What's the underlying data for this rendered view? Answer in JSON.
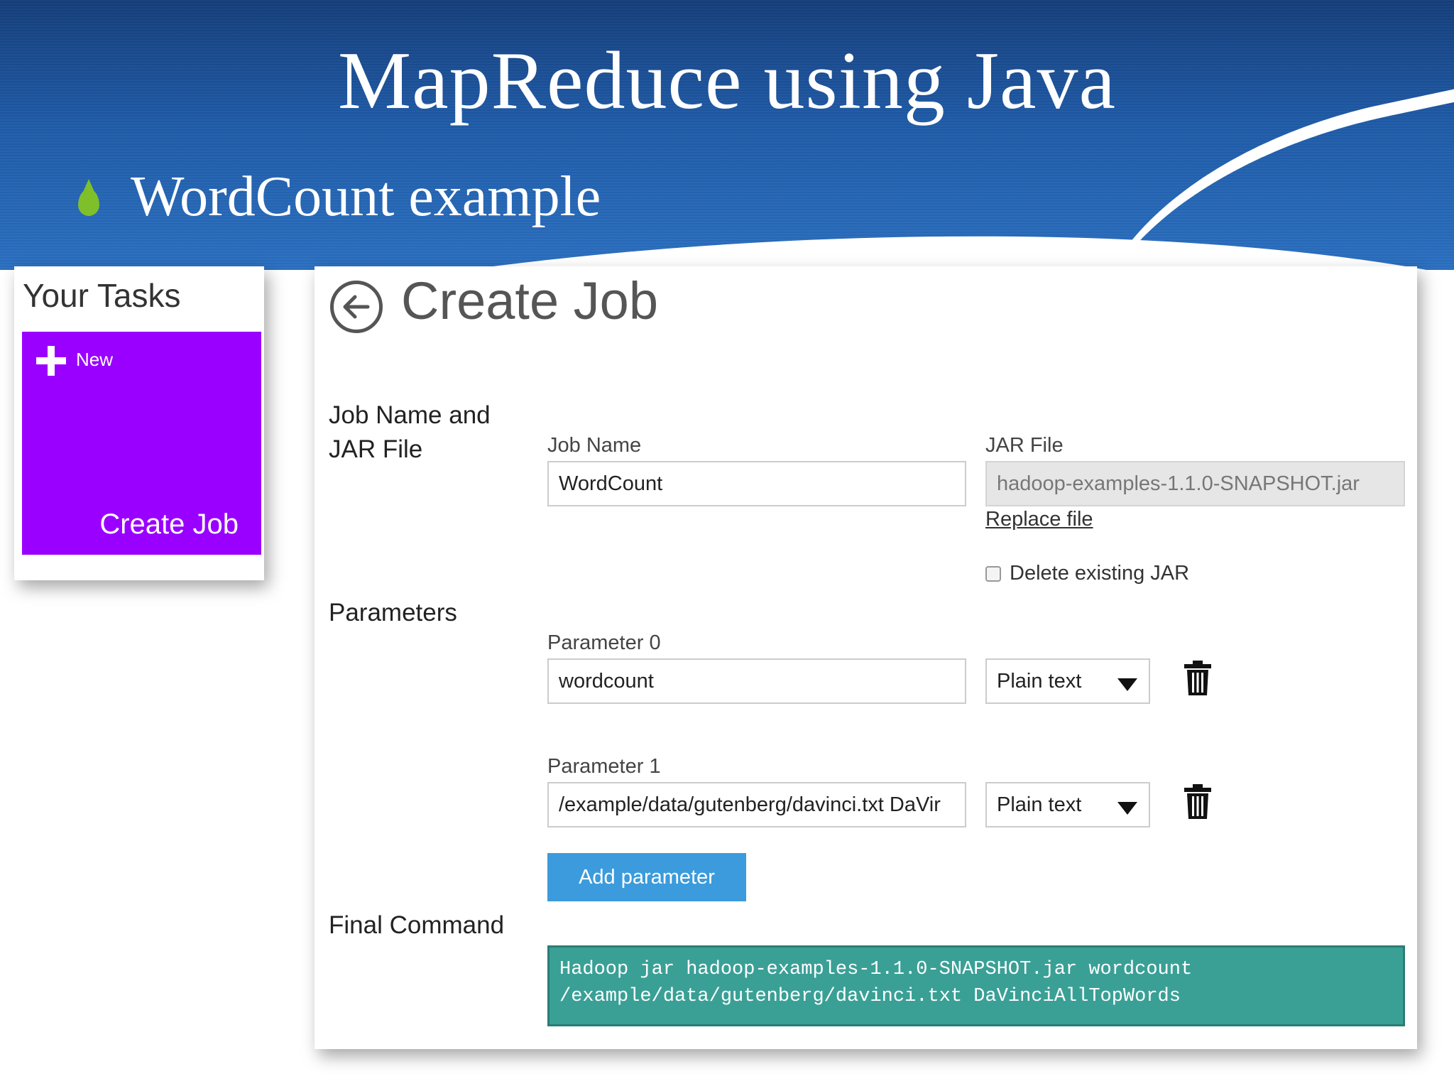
{
  "slide": {
    "title": "MapReduce using Java",
    "bullet": "WordCount example",
    "colors": {
      "title_band": "#1e5aa6",
      "bullet": "#7fbf2a"
    }
  },
  "tasks_panel": {
    "title": "Your Tasks",
    "tile": {
      "new_label": "New",
      "label": "Create Job",
      "color": "#9a00ff",
      "icon": "plus-icon"
    }
  },
  "job_form": {
    "title": "Create Job",
    "back_icon": "back-arrow-circle-icon",
    "sections": {
      "job_name_and_jar": "Job Name and JAR File",
      "parameters": "Parameters",
      "final_command": "Final Command"
    },
    "job_name": {
      "label": "Job Name",
      "value": "WordCount"
    },
    "jar_file": {
      "label": "JAR File",
      "value": "hadoop-examples-1.1.0-SNAPSHOT.jar",
      "replace_link": "Replace file",
      "delete_checkbox_label": "Delete existing JAR",
      "delete_checked": false
    },
    "parameters": [
      {
        "label": "Parameter 0",
        "value": "wordcount",
        "type": "Plain text",
        "delete_icon": "trash-icon"
      },
      {
        "label": "Parameter 1",
        "value": "/example/data/gutenberg/davinci.txt DaVir",
        "type": "Plain text",
        "delete_icon": "trash-icon"
      }
    ],
    "add_parameter_label": "Add parameter",
    "final_command": {
      "line1": "Hadoop jar hadoop-examples-1.1.0-SNAPSHOT.jar wordcount",
      "line2": "/example/data/gutenberg/davinci.txt DaVinciAllTopWords",
      "color": "#3aa096"
    },
    "colors": {
      "button": "#3b9bdc"
    }
  }
}
